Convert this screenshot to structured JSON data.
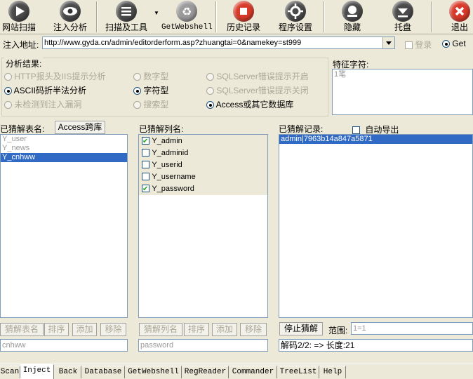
{
  "toolbar": {
    "items": [
      {
        "label": "网站扫描",
        "icon": "play-icon"
      },
      {
        "label": "注入分析",
        "icon": "eye-icon"
      },
      {
        "label": "扫描及工具",
        "icon": "list-icon"
      },
      {
        "label": "GetWebshell",
        "icon": "recycle-icon"
      },
      {
        "label": "历史记录",
        "icon": "stop-icon"
      },
      {
        "label": "程序设置",
        "icon": "settings-icon"
      },
      {
        "label": "隐藏",
        "icon": "hide-icon"
      },
      {
        "label": "托盘",
        "icon": "tray-icon"
      },
      {
        "label": "退出",
        "icon": "exit-icon"
      }
    ]
  },
  "address": {
    "label": "注入地址:",
    "value": "http://www.gyda.cn/admin/editorderform.asp?zhuangtai=0&namekey=st999",
    "login_label": "登录",
    "get_label": "Get"
  },
  "analysis": {
    "title": "分析结果:",
    "options": [
      {
        "label": "HTTP报头及IIS提示分析",
        "type": "radio",
        "checked": false,
        "disabled": true
      },
      {
        "label": "数字型",
        "type": "radio",
        "checked": false,
        "disabled": true
      },
      {
        "label": "SQLServer错误提示开启",
        "type": "radio",
        "checked": false,
        "disabled": true
      },
      {
        "label": "ASCII码折半法分析",
        "type": "radio",
        "checked": true,
        "disabled": false
      },
      {
        "label": "字符型",
        "type": "radio",
        "checked": true,
        "disabled": false
      },
      {
        "label": "SQLServer错误提示关闭",
        "type": "radio",
        "checked": false,
        "disabled": true
      },
      {
        "label": "未检测到注入漏洞",
        "type": "radio",
        "checked": false,
        "disabled": true
      },
      {
        "label": "搜索型",
        "type": "radio",
        "checked": false,
        "disabled": true
      },
      {
        "label": "Access或其它数据库",
        "type": "radio",
        "checked": true,
        "disabled": false
      }
    ]
  },
  "feature": {
    "title": "特征字符:",
    "value": "1笔"
  },
  "tables": {
    "title": "已猜解表名:",
    "access_button": "Access跨库",
    "items": [
      "Y_user",
      "Y_news",
      "Y_cnhww"
    ],
    "selected_index": 2,
    "buttons": [
      "猜解表名",
      "排序",
      "添加",
      "移除"
    ],
    "field": "cnhww"
  },
  "columns": {
    "title": "已猜解列名:",
    "items": [
      {
        "label": "Y_admin",
        "checked": true
      },
      {
        "label": "Y_adminid",
        "checked": false
      },
      {
        "label": "Y_userid",
        "checked": false
      },
      {
        "label": "Y_username",
        "checked": false
      },
      {
        "label": "Y_password",
        "checked": true
      }
    ],
    "buttons": [
      "猜解列名",
      "排序",
      "添加",
      "移除"
    ],
    "field": "password"
  },
  "records": {
    "title": "已猜解记录:",
    "auto_export_label": "自动导出",
    "items": [
      "admin|7963b14a847a5871"
    ],
    "stop_button": "停止猜解",
    "range_label": "范围:",
    "range_value": "1=1",
    "status": "解码2/2: => 长度:21"
  },
  "tabs": [
    "Scan",
    "Inject",
    "Back",
    "Database",
    "GetWebshell",
    "RegReader",
    "Commander",
    "TreeList",
    "Help"
  ],
  "active_tab": 1
}
